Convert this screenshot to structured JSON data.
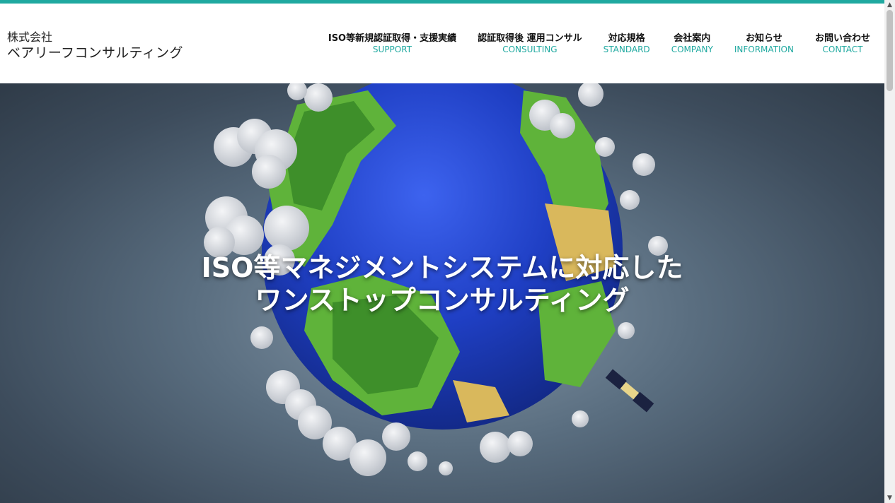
{
  "site": {
    "logo_line1": "株式会社",
    "logo_line2": "ベアリーフコンサルティング"
  },
  "nav": [
    {
      "jp": "ISO等新規認証取得・支援実績",
      "en": "SUPPORT"
    },
    {
      "jp": "認証取得後 運用コンサル",
      "en": "CONSULTING"
    },
    {
      "jp": "対応規格",
      "en": "STANDARD"
    },
    {
      "jp": "会社案内",
      "en": "COMPANY"
    },
    {
      "jp": "お知らせ",
      "en": "INFORMATION"
    },
    {
      "jp": "お問い合わせ",
      "en": "CONTACT"
    }
  ],
  "hero": {
    "line1": "ISO等マネジメントシステムに対応した",
    "line2": "ワンストップコンサルティング",
    "image": "low-poly-globe-with-clouds-and-satellite"
  },
  "colors": {
    "accent": "#1fa9a0",
    "globe_ocean": "#1f3fc4",
    "land": "#5fb33a"
  }
}
